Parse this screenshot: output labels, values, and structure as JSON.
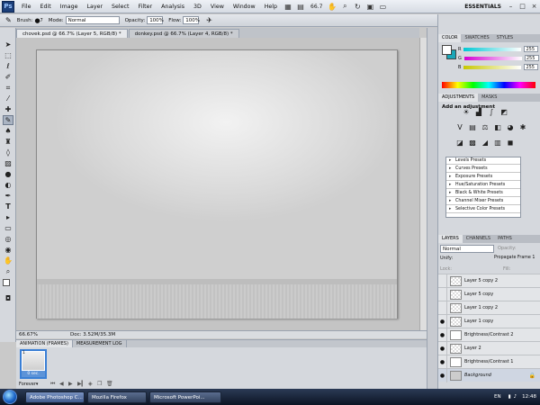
{
  "menubar": {
    "logo": "Ps",
    "items": [
      "File",
      "Edit",
      "Image",
      "Layer",
      "Select",
      "Filter",
      "Analysis",
      "3D",
      "View",
      "Window",
      "Help"
    ],
    "zoom": "66.7",
    "workspace": "ESSENTIALS"
  },
  "options": {
    "brush_label": "Brush:",
    "brush_size": "7",
    "mode_label": "Mode:",
    "mode_value": "Normal",
    "opacity_label": "Opacity:",
    "opacity_value": "100%",
    "flow_label": "Flow:",
    "flow_value": "100%"
  },
  "documents": {
    "tabs": [
      {
        "label": "chovek.psd @ 66.7% (Layer 5, RGB/8) *",
        "active": true
      },
      {
        "label": "donkey.psd @ 66.7% (Layer 4, RGB/8) *",
        "active": false
      }
    ]
  },
  "status": {
    "zoom": "66.67%",
    "doc": "Doc: 3.52M/35.3M"
  },
  "animation": {
    "tabs": [
      "ANIMATION (FRAMES)",
      "MEASUREMENT LOG"
    ],
    "frame_number": "1",
    "frame_delay": "0 sec.",
    "loop": "Forever"
  },
  "color_panel": {
    "tabs": [
      "COLOR",
      "SWATCHES",
      "STYLES"
    ],
    "channels": [
      {
        "label": "R",
        "value": "255",
        "color": "#00c8d4"
      },
      {
        "label": "G",
        "value": "255",
        "color": "#d400d4"
      },
      {
        "label": "B",
        "value": "255",
        "color": "#c8c800"
      }
    ]
  },
  "adjustments": {
    "tabs": [
      "ADJUSTMENTS",
      "MASKS"
    ],
    "title": "Add an adjustment",
    "presets": [
      "Levels Presets",
      "Curves Presets",
      "Exposure Presets",
      "Hue/Saturation Presets",
      "Black & White Presets",
      "Channel Mixer Presets",
      "Selective Color Presets"
    ]
  },
  "layers": {
    "tabs": [
      "LAYERS",
      "CHANNELS",
      "PATHS"
    ],
    "blend_mode": "Normal",
    "opacity_label": "Opacity:",
    "unify_label": "Unify:",
    "propagate_label": "Propagate Frame 1",
    "lock_label": "Lock:",
    "fill_label": "Fill:",
    "items": [
      {
        "name": "Layer 5 copy 2",
        "visible": false
      },
      {
        "name": "Layer 5 copy",
        "visible": false
      },
      {
        "name": "Layer 1 copy 2",
        "visible": false
      },
      {
        "name": "Layer 1 copy",
        "visible": true
      },
      {
        "name": "Brightness/Contrast 2",
        "visible": true
      },
      {
        "name": "Layer 2",
        "visible": true
      },
      {
        "name": "Brightness/Contrast 1",
        "visible": true
      },
      {
        "name": "Background",
        "visible": true
      }
    ]
  },
  "taskbar": {
    "tasks": [
      "Adobe Photoshop C...",
      "Mozilla Firefox",
      "Microsoft PowerPoi..."
    ],
    "lang": "EN",
    "clock": "12:48"
  }
}
